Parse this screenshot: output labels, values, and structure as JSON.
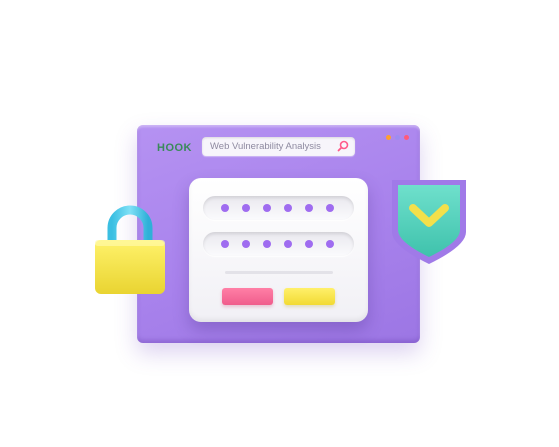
{
  "app": {
    "brand": "HOOK",
    "search": {
      "value": "Web Vulnerability Analysis",
      "icon": "search-icon"
    },
    "window_dots": [
      "#ff9f2f",
      "#9d8cf0",
      "#ff5a7a"
    ]
  },
  "login_card": {
    "fields": [
      {
        "name": "username",
        "masked_chars": 6
      },
      {
        "name": "password",
        "masked_chars": 6
      }
    ],
    "buttons": [
      {
        "name": "cancel",
        "color": "#f36a96"
      },
      {
        "name": "confirm",
        "color": "#f7e44a"
      }
    ],
    "accent": "#9f6cf0"
  },
  "decorations": {
    "padlock": {
      "icon": "padlock-icon",
      "body_color": "#f5e44c",
      "shackle_color": "#3fc7e6"
    },
    "shield": {
      "icon": "shield-check-icon",
      "fill_color": "#5fd3bf",
      "border_color": "#a07ae8",
      "check_color": "#f3e04a"
    }
  }
}
